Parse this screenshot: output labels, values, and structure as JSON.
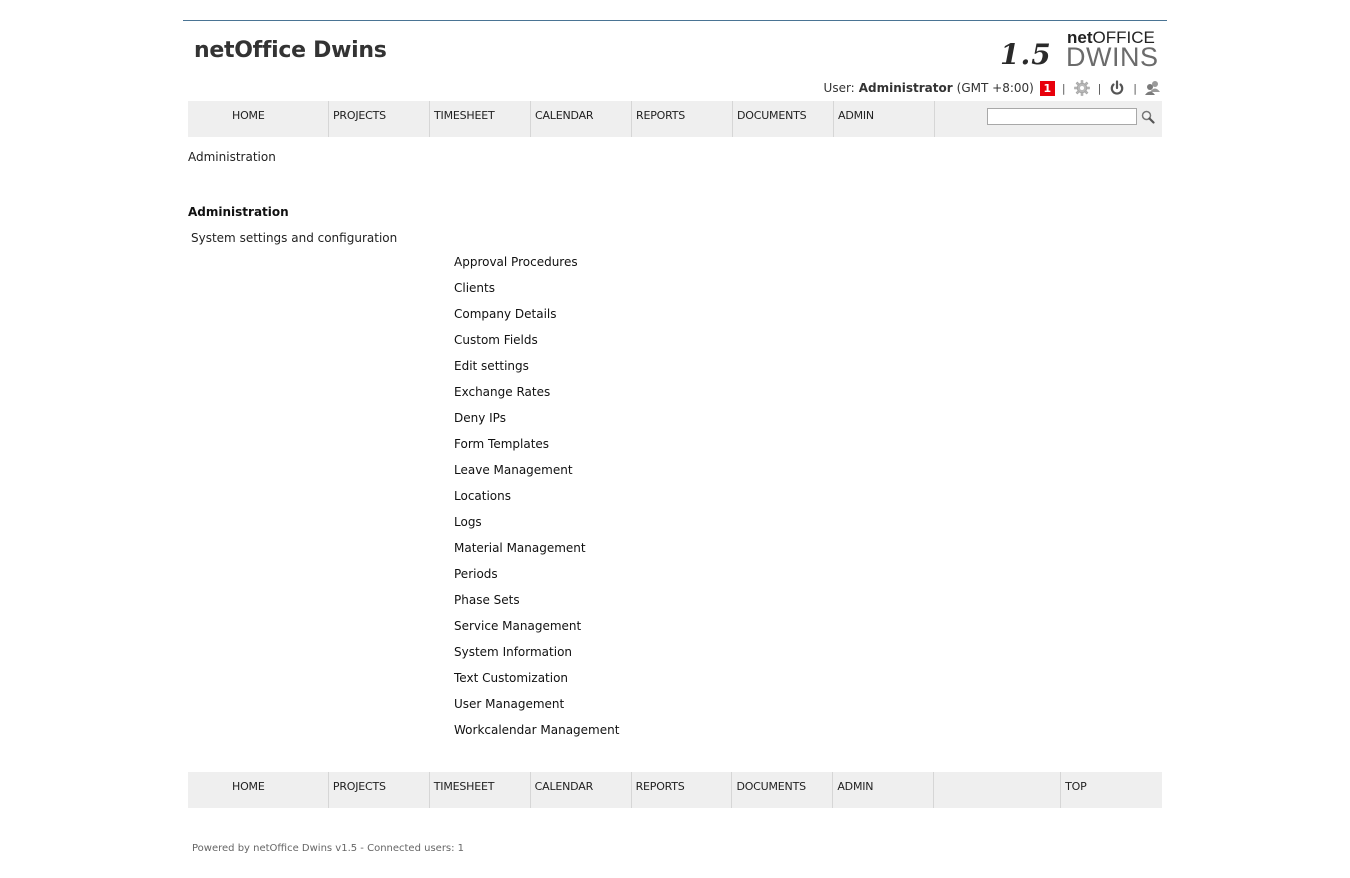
{
  "header": {
    "app_title": "netOffice Dwins",
    "logo": {
      "version": "1.5",
      "net_bold": "net",
      "net_rest": "OFFICE",
      "product": "DWINS"
    }
  },
  "userbar": {
    "user_label": "User:",
    "user_name": "Administrator",
    "timezone": "(GMT +8:00)",
    "notification_count": "1",
    "separator": "|",
    "icons": [
      "gear-icon",
      "power-icon",
      "users-icon"
    ]
  },
  "nav": {
    "items": [
      "HOME",
      "PROJECTS",
      "TIMESHEET",
      "CALENDAR",
      "REPORTS",
      "DOCUMENTS",
      "ADMIN"
    ],
    "search_placeholder": "",
    "search_value": ""
  },
  "footer_nav": {
    "items": [
      "HOME",
      "PROJECTS",
      "TIMESHEET",
      "CALENDAR",
      "REPORTS",
      "DOCUMENTS",
      "ADMIN"
    ],
    "top_label": "TOP"
  },
  "breadcrumb": "Administration",
  "section": {
    "title": "Administration",
    "description": "System settings and configuration"
  },
  "admin_links": [
    "Approval Procedures",
    "Clients",
    "Company Details",
    "Custom Fields",
    "Edit settings",
    "Exchange Rates",
    "Deny IPs",
    "Form Templates",
    "Leave Management",
    "Locations",
    "Logs",
    "Material Management",
    "Periods",
    "Phase Sets",
    "Service Management",
    "System Information",
    "Text Customization",
    "User Management",
    "Workcalendar Management"
  ],
  "footer": {
    "text": "Powered by netOffice Dwins v1.5 - Connected users: 1"
  },
  "colors": {
    "top_rule": "#4a7494",
    "nav_bg": "#efefef",
    "badge": "#e8000b"
  }
}
